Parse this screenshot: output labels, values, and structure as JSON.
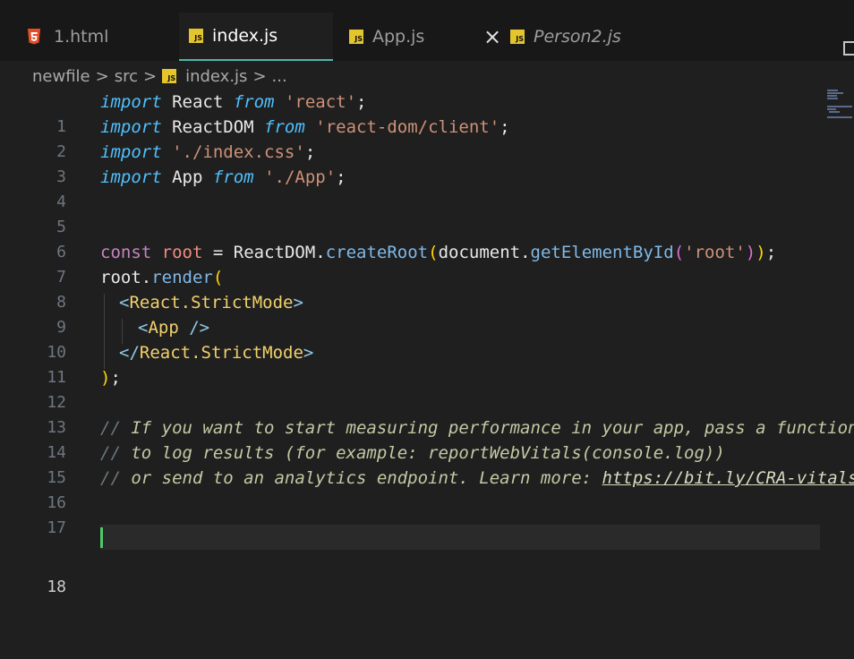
{
  "tabs": [
    {
      "label": "1.html",
      "icon": "html5-icon",
      "active": false
    },
    {
      "label": "index.js",
      "icon": "js-icon",
      "active": true
    },
    {
      "label": "App.js",
      "icon": "js-icon",
      "active": false
    },
    {
      "label": "Person2.js",
      "icon": "js-icon",
      "active": false,
      "preview": true
    }
  ],
  "close_glyph": "×",
  "js_badge": "JS",
  "breadcrumb": {
    "items": [
      "newfile",
      "src",
      "index.js",
      "..."
    ],
    "separator": ">"
  },
  "editor": {
    "current_line": 18,
    "line_numbers": [
      "1",
      "2",
      "3",
      "4",
      "5",
      "6",
      "7",
      "8",
      "9",
      "10",
      "11",
      "12",
      "13",
      "14",
      "15",
      "16",
      "17",
      "18"
    ],
    "tokens": {
      "l1": [
        "import",
        " React ",
        "from",
        " ",
        "'react'",
        ";"
      ],
      "l2": [
        "import",
        " ReactDOM ",
        "from",
        " ",
        "'react-dom/client'",
        ";"
      ],
      "l3": [
        "import",
        " ",
        "'./index.css'",
        ";"
      ],
      "l4": [
        "import",
        " App ",
        "from",
        " ",
        "'./App'",
        ";"
      ],
      "l7": [
        "const",
        " ",
        "root",
        " = ",
        "ReactDOM",
        ".",
        "createRoot",
        "(",
        "document",
        ".",
        "getElementById",
        "(",
        "'root'",
        ")",
        ")",
        ";"
      ],
      "l8": [
        "root",
        ".",
        "render",
        "("
      ],
      "l9": [
        "<",
        "React.StrictMode",
        ">"
      ],
      "l10": [
        "<",
        "App",
        " />"
      ],
      "l11": [
        "</",
        "React.StrictMode",
        ">"
      ],
      "l12": [
        ")",
        ";"
      ],
      "l14": [
        "// ",
        "If you want to start measuring performance in your app, pass a function"
      ],
      "l15": [
        "// ",
        "to log results (for example: reportWebVitals(console.log))"
      ],
      "l16": [
        "// ",
        "or send to an analytics endpoint. Learn more: ",
        "https://bit.ly/CRA-vitals"
      ]
    }
  },
  "colors": {
    "background": "#1f1f1f",
    "tab_bar": "#181818",
    "active_tab_underline": "#4db6ac",
    "cursor": "#4ec96a"
  }
}
